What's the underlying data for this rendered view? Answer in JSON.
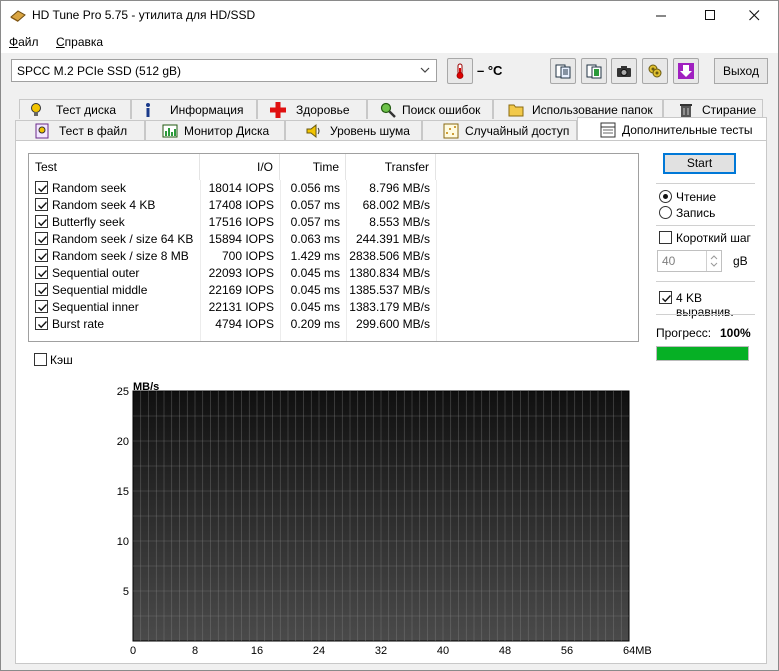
{
  "window": {
    "title": "HD Tune Pro 5.75 - утилита для HD/SSD"
  },
  "menu": {
    "file_u": "Ф",
    "file_rest": "айл",
    "help_u": "С",
    "help_rest": "правка"
  },
  "toolbar": {
    "drive": "SPCC M.2 PCIe SSD (512 gB)",
    "temperature": "– °C",
    "exit_label": "Выход"
  },
  "tabs_row1": [
    {
      "label": "Тест диска",
      "icon": "test-disk-icon"
    },
    {
      "label": "Информация",
      "icon": "info-icon"
    },
    {
      "label": "Здоровье",
      "icon": "health-cross-icon"
    },
    {
      "label": "Поиск ошибок",
      "icon": "magnifier-icon"
    },
    {
      "label": "Использование папок",
      "icon": "folder-icon"
    },
    {
      "label": "Стирание",
      "icon": "trash-icon"
    }
  ],
  "tabs_row2": [
    {
      "label": "Тест в файл",
      "icon": "file-test-icon"
    },
    {
      "label": "Монитор Диска",
      "icon": "monitor-icon"
    },
    {
      "label": "Уровень шума",
      "icon": "speaker-icon"
    },
    {
      "label": "Случайный доступ",
      "icon": "random-access-icon"
    },
    {
      "label": "Дополнительные  тесты",
      "icon": "extra-tests-icon",
      "active": true
    }
  ],
  "results": {
    "headers": {
      "test": "Test",
      "io": "I/O",
      "time": "Time",
      "transfer": "Transfer"
    },
    "rows": [
      {
        "checked": true,
        "test": "Random seek",
        "io": "18014 IOPS",
        "time": "0.056 ms",
        "transfer": "8.796 MB/s"
      },
      {
        "checked": true,
        "test": "Random seek 4 KB",
        "io": "17408 IOPS",
        "time": "0.057 ms",
        "transfer": "68.002 MB/s"
      },
      {
        "checked": true,
        "test": "Butterfly seek",
        "io": "17516 IOPS",
        "time": "0.057 ms",
        "transfer": "8.553 MB/s"
      },
      {
        "checked": true,
        "test": "Random seek / size 64 KB",
        "io": "15894 IOPS",
        "time": "0.063 ms",
        "transfer": "244.391 MB/s"
      },
      {
        "checked": true,
        "test": "Random seek / size 8 MB",
        "io": "700 IOPS",
        "time": "1.429 ms",
        "transfer": "2838.506 MB/s"
      },
      {
        "checked": true,
        "test": "Sequential outer",
        "io": "22093 IOPS",
        "time": "0.045 ms",
        "transfer": "1380.834 MB/s"
      },
      {
        "checked": true,
        "test": "Sequential middle",
        "io": "22169 IOPS",
        "time": "0.045 ms",
        "transfer": "1385.537 MB/s"
      },
      {
        "checked": true,
        "test": "Sequential inner",
        "io": "22131 IOPS",
        "time": "0.045 ms",
        "transfer": "1383.179 MB/s"
      },
      {
        "checked": true,
        "test": "Burst rate",
        "io": "4794 IOPS",
        "time": "0.209 ms",
        "transfer": "299.600 MB/s"
      }
    ]
  },
  "controls": {
    "start_label": "Start",
    "read_label": "Чтение",
    "write_label": "Запись",
    "mode": "read",
    "short_step_label": "Короткий шаг",
    "short_step_checked": false,
    "step_value": "40",
    "step_unit": "gB",
    "align_label": "4 KB выравнив.",
    "align_checked": true,
    "progress_label": "Прогресс:",
    "progress_text": "100%",
    "progress_value": 1.0,
    "cache_label": "Кэш",
    "cache_checked": false
  },
  "chart_data": {
    "type": "line",
    "ylabel": "MB/s",
    "xlabel": "",
    "xunit": "MB",
    "ylim": [
      0,
      25
    ],
    "xlim": [
      0,
      64
    ],
    "yticks": [
      25,
      20,
      15,
      10,
      5
    ],
    "xticks": [
      0,
      8,
      16,
      24,
      32,
      40,
      48,
      56,
      64
    ],
    "series": [],
    "grid": true,
    "background": "#1a1a1a"
  }
}
